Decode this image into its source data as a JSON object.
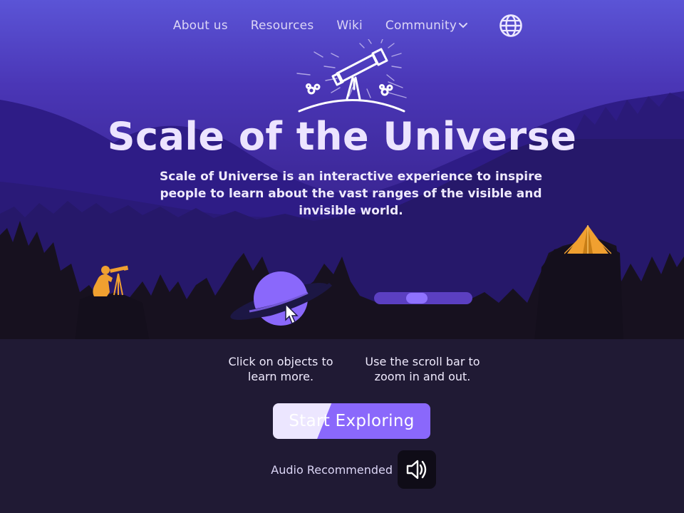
{
  "nav": {
    "items": [
      {
        "label": "About us"
      },
      {
        "label": "Resources"
      },
      {
        "label": "Wiki"
      },
      {
        "label": "Community",
        "has_dropdown": true
      }
    ],
    "globe_icon": "globe-icon"
  },
  "hero": {
    "title": "Scale of the Universe",
    "subtitle": "Scale of Universe is an interactive experience to inspire people to learn about the vast ranges of the visible and invisible world."
  },
  "scene": {
    "icons": [
      "telescope-logo-icon",
      "stargazer-icon",
      "planet-icon",
      "cursor-icon",
      "tent-icon"
    ]
  },
  "zoom_slider": {
    "value": 0.33
  },
  "hints": {
    "click_objects": "Click on objects to learn more.",
    "scroll_bar": "Use the scroll bar to zoom in and out."
  },
  "cta": {
    "start_label": "Start Exploring"
  },
  "audio": {
    "label": "Audio Recommended",
    "icon": "speaker-icon"
  },
  "colors": {
    "sky_top": "#5a4fd0",
    "sky_mid": "#3f2a9b",
    "ground": "#201a34",
    "accent": "#8a68fb",
    "orange": "#f0a030"
  }
}
